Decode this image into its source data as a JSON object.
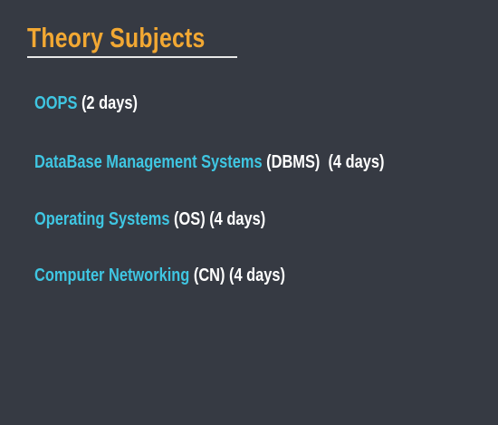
{
  "title": "Theory Subjects",
  "items": [
    {
      "name": "OOPS",
      "rest": "(2 days)"
    },
    {
      "name": "DataBase Management Systems",
      "rest": "(DBMS)  (4 days)"
    },
    {
      "name": "Operating Systems",
      "rest": "(OS) (4 days)"
    },
    {
      "name": "Computer Networking",
      "rest": "(CN) (4 days)"
    }
  ],
  "colors": {
    "background": "#363a43",
    "title": "#f2a833",
    "highlight": "#3fc6e2"
  }
}
